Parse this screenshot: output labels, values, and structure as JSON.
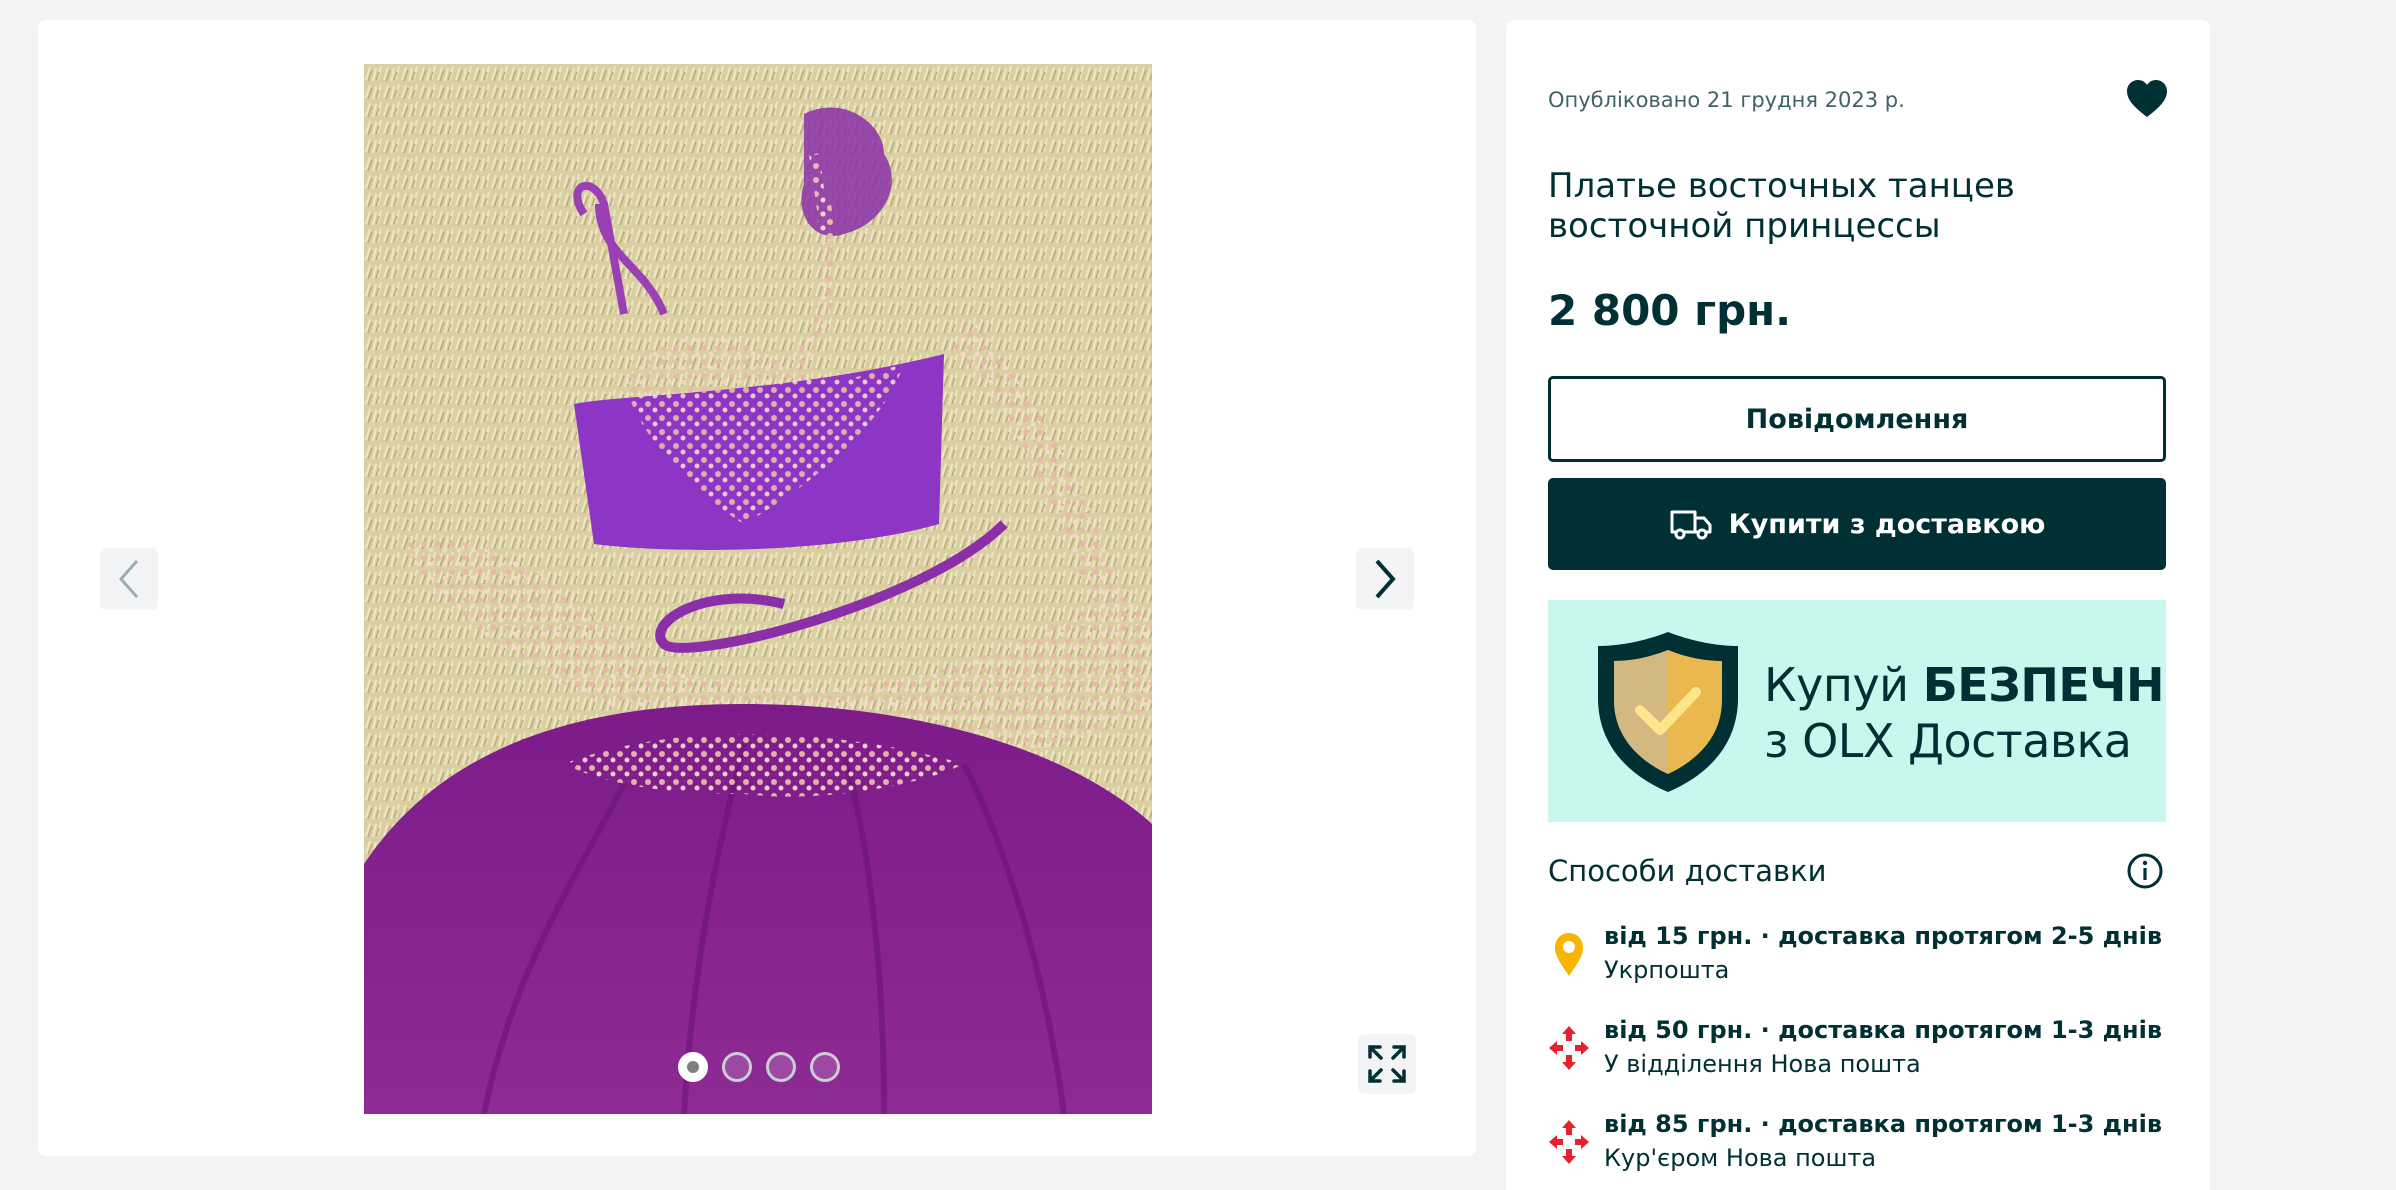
{
  "gallery": {
    "image_alt": "Purple belly dance costume",
    "prev_label": "previous-photo",
    "next_label": "next-photo",
    "slides_count": 4,
    "active_slide": 1
  },
  "listing": {
    "posted": "Опубліковано 21 грудня 2023 р.",
    "title": "Платье восточных танцев восточной принцессы",
    "price": "2 800 грн.",
    "message_label": "Повідомлення",
    "buy_label": "Купити з доставкою"
  },
  "promo": {
    "line1_regular": "Купуй ",
    "line1_bold": "БЕЗПЕЧНО",
    "line2": "з OLX Доставка"
  },
  "delivery": {
    "title": "Способи доставки",
    "items": [
      {
        "main": "від 15 грн. · доставка протягом 2-5 днів",
        "sub": "Укрпошта",
        "icon": "ukrposhta-icon"
      },
      {
        "main": "від 50 грн. · доставка протягом 1-3 днів",
        "sub": "У відділення Нова пошта",
        "icon": "nova-poshta-icon"
      },
      {
        "main": "від 85 грн. · доставка протягом 1-3 днів",
        "sub": "Кур'єром Нова пошта",
        "icon": "nova-poshta-icon"
      }
    ]
  },
  "colors": {
    "brand_dark": "#002f34",
    "promo_bg": "#c8f8ed",
    "page_bg": "#f2f4f5",
    "ukrposhta": "#f7b500",
    "nova_poshta": "#e4222d"
  }
}
